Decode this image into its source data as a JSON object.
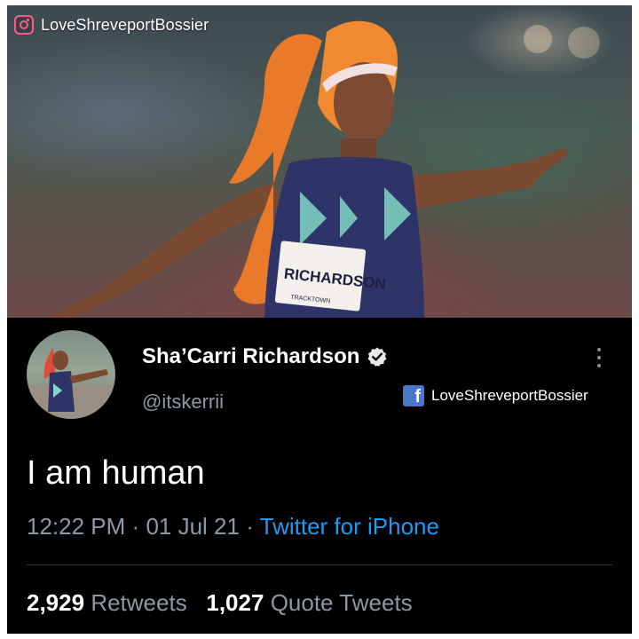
{
  "photo": {
    "instagram_handle": "LoveShreveportBossier",
    "instagram_icon": "instagram-icon",
    "bib_name": "RICHARDSON",
    "bib_footer": "TRACKTOWN"
  },
  "tweet": {
    "display_name": "Sha’Carri Richardson",
    "verified_icon": "verified-badge-icon",
    "handle": "@itskerrii",
    "facebook_icon": "facebook-icon",
    "facebook_handle": "LoveShreveportBossier",
    "text": "I am human",
    "time": "12:22 PM",
    "separator": "·",
    "date": "01 Jul 21",
    "source": "Twitter for iPhone",
    "retweets_count": "2,929",
    "retweets_label": "Retweets",
    "quote_count": "1,027",
    "quote_label": "Quote Tweets"
  },
  "colors": {
    "background": "#000000",
    "secondary_text": "#8b98a5",
    "link_blue": "#1d9bf0",
    "facebook_blue": "#4a78c8",
    "instagram_pink": "#ff5b8a"
  }
}
